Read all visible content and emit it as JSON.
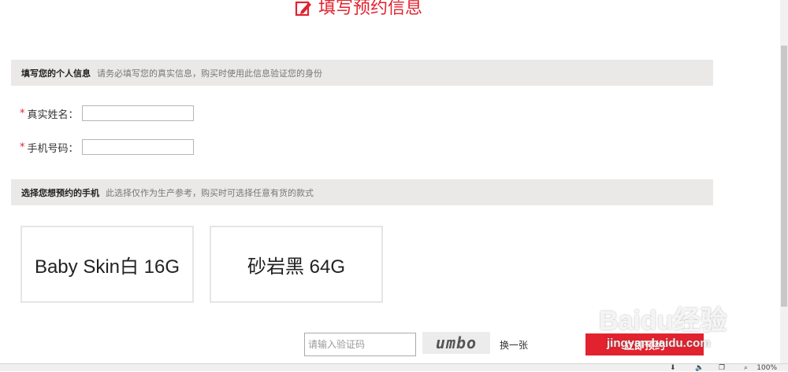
{
  "header": {
    "title": "填写预约信息"
  },
  "personal": {
    "title": "填写您的个人信息",
    "desc": "请务必填写您的真实信息，购买时使用此信息验证您的身份",
    "name_label": "真实姓名：",
    "phone_label": "手机号码：",
    "required_mark": "*"
  },
  "phone_select": {
    "title": "选择您想预约的手机",
    "desc": "此选择仅作为生产参考，购买时可选择任意有货的款式",
    "options": [
      {
        "label": "Baby Skin白 16G"
      },
      {
        "label": "砂岩黑 64G"
      }
    ]
  },
  "captcha": {
    "placeholder": "请输入验证码",
    "image_text": "umbo",
    "refresh_label": "换一张"
  },
  "submit": {
    "label": "立即预约"
  },
  "watermark": {
    "text": "Baidu经验",
    "sub": "jingyan.baidu.com"
  },
  "statusbar": {
    "zoom": "100%"
  },
  "colors": {
    "accent": "#e2222f",
    "section_bg": "#ebe9e8"
  }
}
